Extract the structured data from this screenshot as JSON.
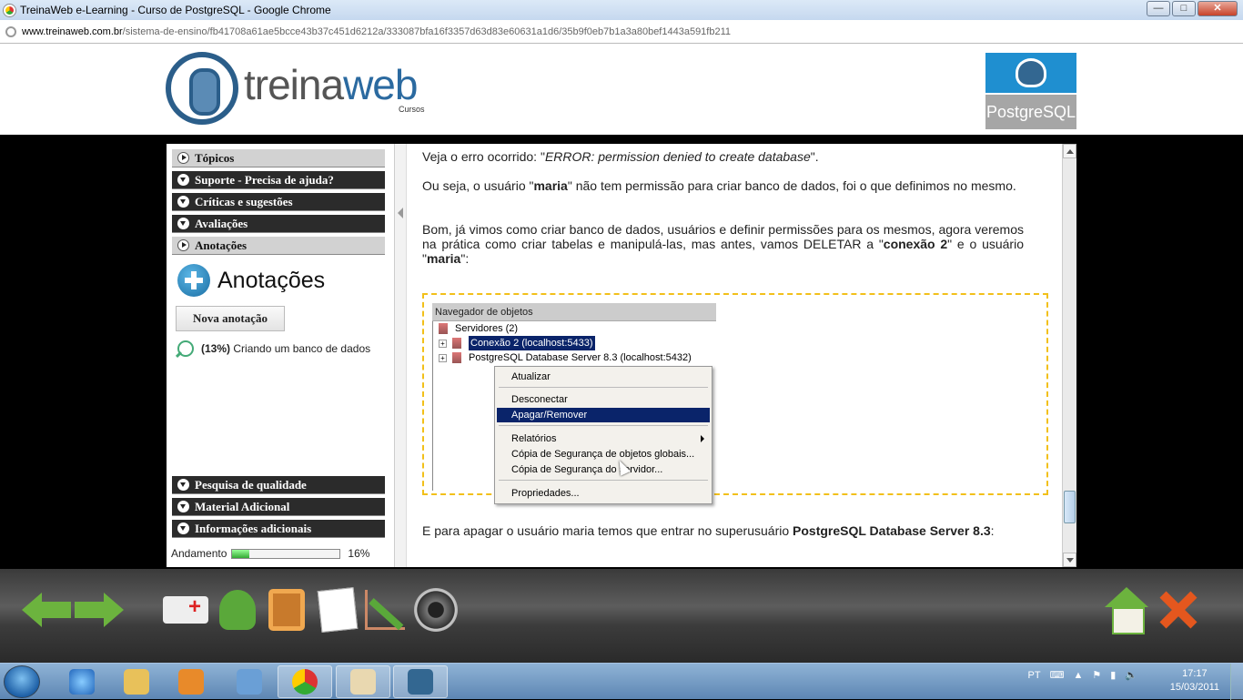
{
  "window": {
    "title": "TreinaWeb e-Learning - Curso de PostgreSQL - Google Chrome",
    "min": "—",
    "max": "□",
    "close": "✕"
  },
  "address": {
    "domain": "www.treinaweb.com.br",
    "path": "/sistema-de-ensino/fb41708a61ae5bcce43b37c451d6212a/333087bfa16f3357d63d83e60631a1d6/35b9f0eb7b1a3a80bef1443a591fb211"
  },
  "header": {
    "logo_word_a": "treina",
    "logo_word_b": "web",
    "logo_sub": "Cursos",
    "course_badge": "PostgreSQL"
  },
  "sidebar": {
    "top_items": [
      {
        "label": "Tópicos",
        "style": "light"
      },
      {
        "label": "Suporte - Precisa de ajuda?",
        "style": "dark"
      },
      {
        "label": "Críticas e sugestões",
        "style": "dark"
      },
      {
        "label": "Avaliações",
        "style": "dark"
      },
      {
        "label": "Anotações",
        "style": "light"
      }
    ],
    "anotacoes_title": "Anotações",
    "nova_button": "Nova anotação",
    "note_percent": "(13%)",
    "note_text": "Criando um banco de dados",
    "bottom_items": [
      {
        "label": "Pesquisa de qualidade"
      },
      {
        "label": "Material Adicional"
      },
      {
        "label": "Informações adicionais"
      }
    ],
    "progress_label": "Andamento",
    "progress_value": 0.16,
    "progress_text": "16%"
  },
  "content": {
    "p1_a": "Veja o erro ocorrido: \"",
    "p1_em": "ERROR: permission denied to create database",
    "p1_b": "\".",
    "p2_a": "Ou seja, o usuário \"",
    "p2_b1": "maria",
    "p2_c": "\" não tem permissão para criar banco de dados, foi o que definimos no mesmo.",
    "p3_a": "Bom, já vimos como criar banco de dados, usuários e definir permissões para os mesmos, agora veremos na prática como criar tabelas e manipulá-las, mas antes, vamos DELETAR a \"",
    "p3_b1": "conexão 2",
    "p3_c": "\" e o usuário \"",
    "p3_b2": "maria",
    "p3_d": "\":",
    "p4_a": "E para apagar o usuário maria temos que entrar no superusuário ",
    "p4_b": "PostgreSQL Database Server 8.3",
    "p4_c": ":"
  },
  "screenshot": {
    "panel_title": "Navegador de objetos",
    "root": "Servidores (2)",
    "node1": "Conexão 2 (localhost:5433)",
    "node2": "PostgreSQL Database Server 8.3 (localhost:5432)",
    "menu": [
      {
        "label": "Atualizar"
      },
      {
        "label": "Desconectar"
      },
      {
        "label": "Apagar/Remover",
        "highlight": true
      },
      {
        "label": "Relatórios",
        "submenu": true
      },
      {
        "label": "Cópia de Segurança de objetos globais..."
      },
      {
        "label": "Cópia de Segurança do servidor..."
      },
      {
        "label": "Propriedades..."
      }
    ]
  },
  "toolbar": {
    "icons": [
      "back-arrow-icon",
      "forward-arrow-icon",
      "ambulance-icon",
      "user-edit-icon",
      "clipboard-icon",
      "notepad-edit-icon",
      "chart-icon",
      "sync-icon",
      "home-icon",
      "close-x-icon"
    ]
  },
  "taskbar": {
    "lang": "PT",
    "time": "17:17",
    "date": "15/03/2011",
    "apps": [
      "internet-explorer",
      "windows-explorer",
      "media-player",
      "virtualbox",
      "chrome",
      "paint",
      "pgadmin"
    ]
  }
}
